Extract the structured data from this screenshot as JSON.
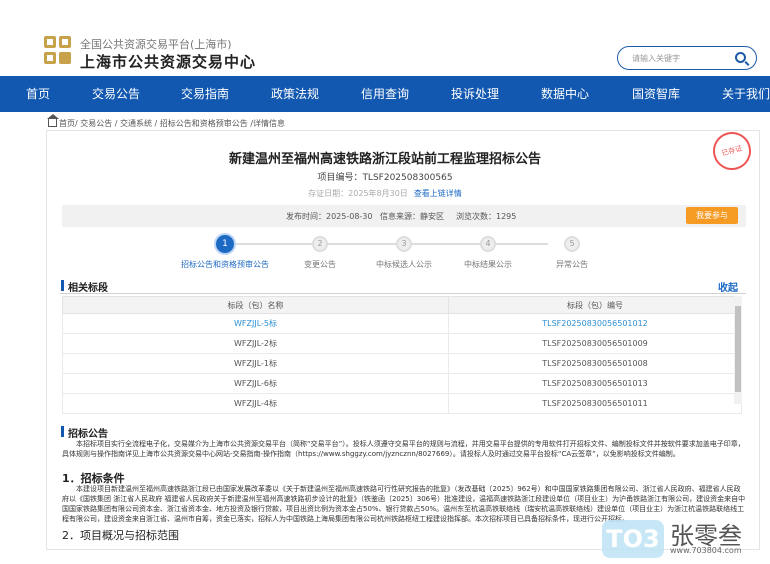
{
  "header": {
    "site_sub": "全国公共资源交易平台(上海市)",
    "site_main": "上海市公共资源交易中心",
    "search_placeholder": "请输入关键字"
  },
  "nav": [
    "首页",
    "交易公告",
    "交易指南",
    "政策法规",
    "信用查询",
    "投诉处理",
    "数据中心",
    "国资智库",
    "关于我们"
  ],
  "breadcrumb": "首页/ 交易公告 / 交通系统 / 招标公告和资格预审公告 /详情信息",
  "notice": {
    "title": "新建温州至福州高速铁路浙江段站前工程监理招标公告",
    "project_no": "项目编号：TLSF202508300565",
    "deposit_date": "存证日期：2025年8月30日",
    "deposit_link": "查看上链详情",
    "stamp": "已存证",
    "publish_time": "发布时间：2025-08-30",
    "source": "信息来源：静安区",
    "views": "浏览次数：1295",
    "join_button": "我要参与"
  },
  "steps": [
    {
      "num": "1",
      "label": "招标公告和资格预审公告"
    },
    {
      "num": "2",
      "label": "变更公告"
    },
    {
      "num": "3",
      "label": "中标候选人公示"
    },
    {
      "num": "4",
      "label": "中标结果公示"
    },
    {
      "num": "5",
      "label": "异常公告"
    }
  ],
  "related": {
    "heading": "相关标段",
    "collapse": "收起",
    "col_name": "标段（包）名称",
    "col_no": "标段（包）编号",
    "rows": [
      {
        "name": "WFZJJL-5标",
        "no": "TLSF20250830056501012"
      },
      {
        "name": "WFZJJL-2标",
        "no": "TLSF20250830056501009"
      },
      {
        "name": "WFZJJL-1标",
        "no": "TLSF20250830056501008"
      },
      {
        "name": "WFZJJL-6标",
        "no": "TLSF20250830056501013"
      },
      {
        "name": "WFZJJL-4标",
        "no": "TLSF20250830056501011"
      }
    ]
  },
  "announcement": {
    "heading": "招标公告",
    "intro": "本招标项目实行全流程电子化，交易媒介为上海市公共资源交易平台（简称“交易平台”）。投标人须遵守交易平台的规则与流程，并用交易平台提供的专用软件打开招标文件、编制投标文件并按软件要求加盖电子印章，具体规则与操作指南详见上海市公共资源交易中心网站-交易指南-操作指南（https://www.shggzy.com/jyzncznn/8027669）。请投标人及时通过交易平台投标“CA云签章”，以免影响投标文件编制。",
    "sec1": "1．招标条件",
    "sec1_text": "本建设项目新建温州至福州高速铁路浙江段已由国家发展改革委以《关于新建温州至福州高速铁路可行性研究报告的批复》（发改基础〔2025〕962号）和中国国家铁路集团有限公司、浙江省人民政府、福建省人民政府以《国铁集团 浙江省人民政府 福建省人民政府关于新建温州至福州高速铁路初步设计的批复》（铁鉴函〔2025〕306号）批准建设，温福高速铁路浙江段建设单位（项目业主）为沪甬铁路浙江有限公司，建设资金来自中国国家铁路集团有限公司资本金、浙江省资本金、地方投资及银行贷款，项目出资比例为资本金占50%、银行贷款占50%。温州东至杭温高铁联络线（瑞安杭温高铁联络线）建设单位（项目业主）为浙江杭温铁路联络线工程有限公司，建设资金来自浙江省、温州市自筹，资金已落实，招标人为中国铁路上海局集团有限公司杭州铁路枢纽工程建设指挥部。本次招标项目已具备招标条件，现进行公开招标。",
    "sec2": "2．项目概况与招标范围"
  },
  "watermark": {
    "brand": "TO3",
    "name": "张零叁",
    "url": "www.703804.com"
  }
}
